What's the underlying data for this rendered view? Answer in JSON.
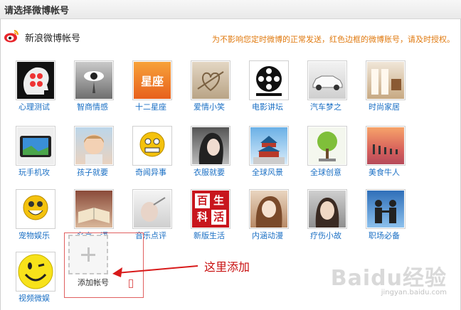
{
  "header": {
    "title": "请选择微博帐号"
  },
  "account": {
    "name": "新浪微博帐号"
  },
  "notice": "为不影响您定时微博的正常发送，红色边框的微博账号，请及时授权。",
  "accounts": [
    {
      "label": "心理测试"
    },
    {
      "label": "智商情感"
    },
    {
      "label": "十二星座"
    },
    {
      "label": "爱情小笑"
    },
    {
      "label": "电影讲坛"
    },
    {
      "label": "汽车梦之"
    },
    {
      "label": "时尚家居"
    },
    {
      "label": "玩手机攻"
    },
    {
      "label": "孩子就要"
    },
    {
      "label": "奇闻异事"
    },
    {
      "label": "衣服就要"
    },
    {
      "label": "全球风景"
    },
    {
      "label": "全球创意"
    },
    {
      "label": "美食牛人"
    },
    {
      "label": "宠物娱乐"
    },
    {
      "label": "名言、语"
    },
    {
      "label": "音乐点评"
    },
    {
      "label": "新版生活"
    },
    {
      "label": "内涵动漫"
    },
    {
      "label": "疗伤小故"
    },
    {
      "label": "职场必备"
    },
    {
      "label": "视频微娱"
    }
  ],
  "thumb_text": {
    "star": "星座",
    "life": [
      "百",
      "生",
      "科",
      "活"
    ]
  },
  "add": {
    "label": "添加帐号"
  },
  "annotation": "这里添加",
  "watermark": {
    "brand": "Baidu经验",
    "url": "jingyan.baidu.com"
  }
}
